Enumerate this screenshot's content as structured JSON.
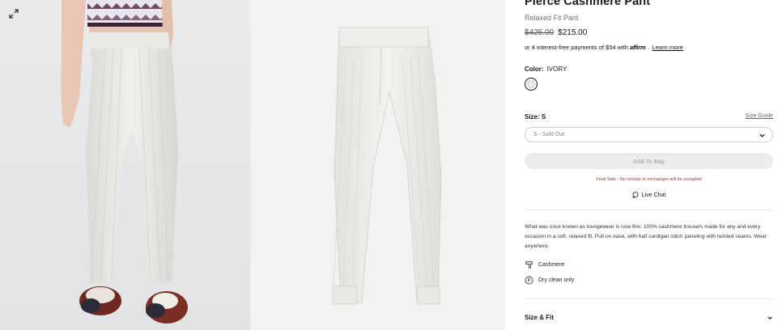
{
  "product": {
    "title": "Pierce Cashmere Pant",
    "subtitle": "Relaxed Fit Pant",
    "price_original": "$425.00",
    "price_sale": "$215.00",
    "affirm_prefix": "or 4 interest-free payments of $54 with",
    "affirm_brand": "affirm",
    "affirm_link": "Learn more"
  },
  "color": {
    "label": "Color:",
    "value": "IVORY",
    "swatch_hex": "#ecebe6"
  },
  "size": {
    "label": "Size: S",
    "guide_link": "Size Guide",
    "selected_option": "S - Sold Out"
  },
  "actions": {
    "add_to_bag": "Add To Bag",
    "final_sale": "Final Sale - No returns or exchanges will be accepted",
    "live_chat": "Live Chat"
  },
  "details": {
    "description": "What was once known as loungewear is now this: 100% cashmere trousers made for any and every occasion in a soft, relaxed fit. Pull-on ease, with half cardigan stitch paneling with twisted seams. Wear anywhere.",
    "material": "Cashmere",
    "care": "Dry clean only",
    "care_icon_letter": "P"
  },
  "accordion": {
    "size_fit": "Size & Fit"
  },
  "icons": {
    "expand": "expand-icon",
    "chevron": "chevron-down-icon",
    "chat": "chat-bubble-icon",
    "material": "fabric-icon",
    "care": "dry-clean-icon"
  },
  "colors": {
    "sale_text": "#8a3b3b",
    "disabled_button": "#ececec",
    "garment_ivory": "#ecebe6"
  }
}
